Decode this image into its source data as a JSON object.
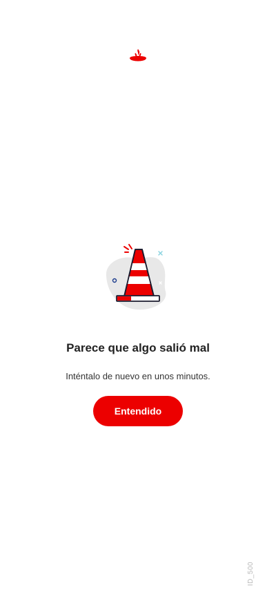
{
  "brand": {
    "logo_icon": "santander-flame-icon",
    "accent_color": "#ec0000"
  },
  "error": {
    "illustration_icon": "traffic-cone-icon",
    "title": "Parece que algo salió mal",
    "message": "Inténtalo de nuevo en unos minutos."
  },
  "actions": {
    "primary_label": "Entendido"
  },
  "footer": {
    "screen_id": "ID_500"
  }
}
